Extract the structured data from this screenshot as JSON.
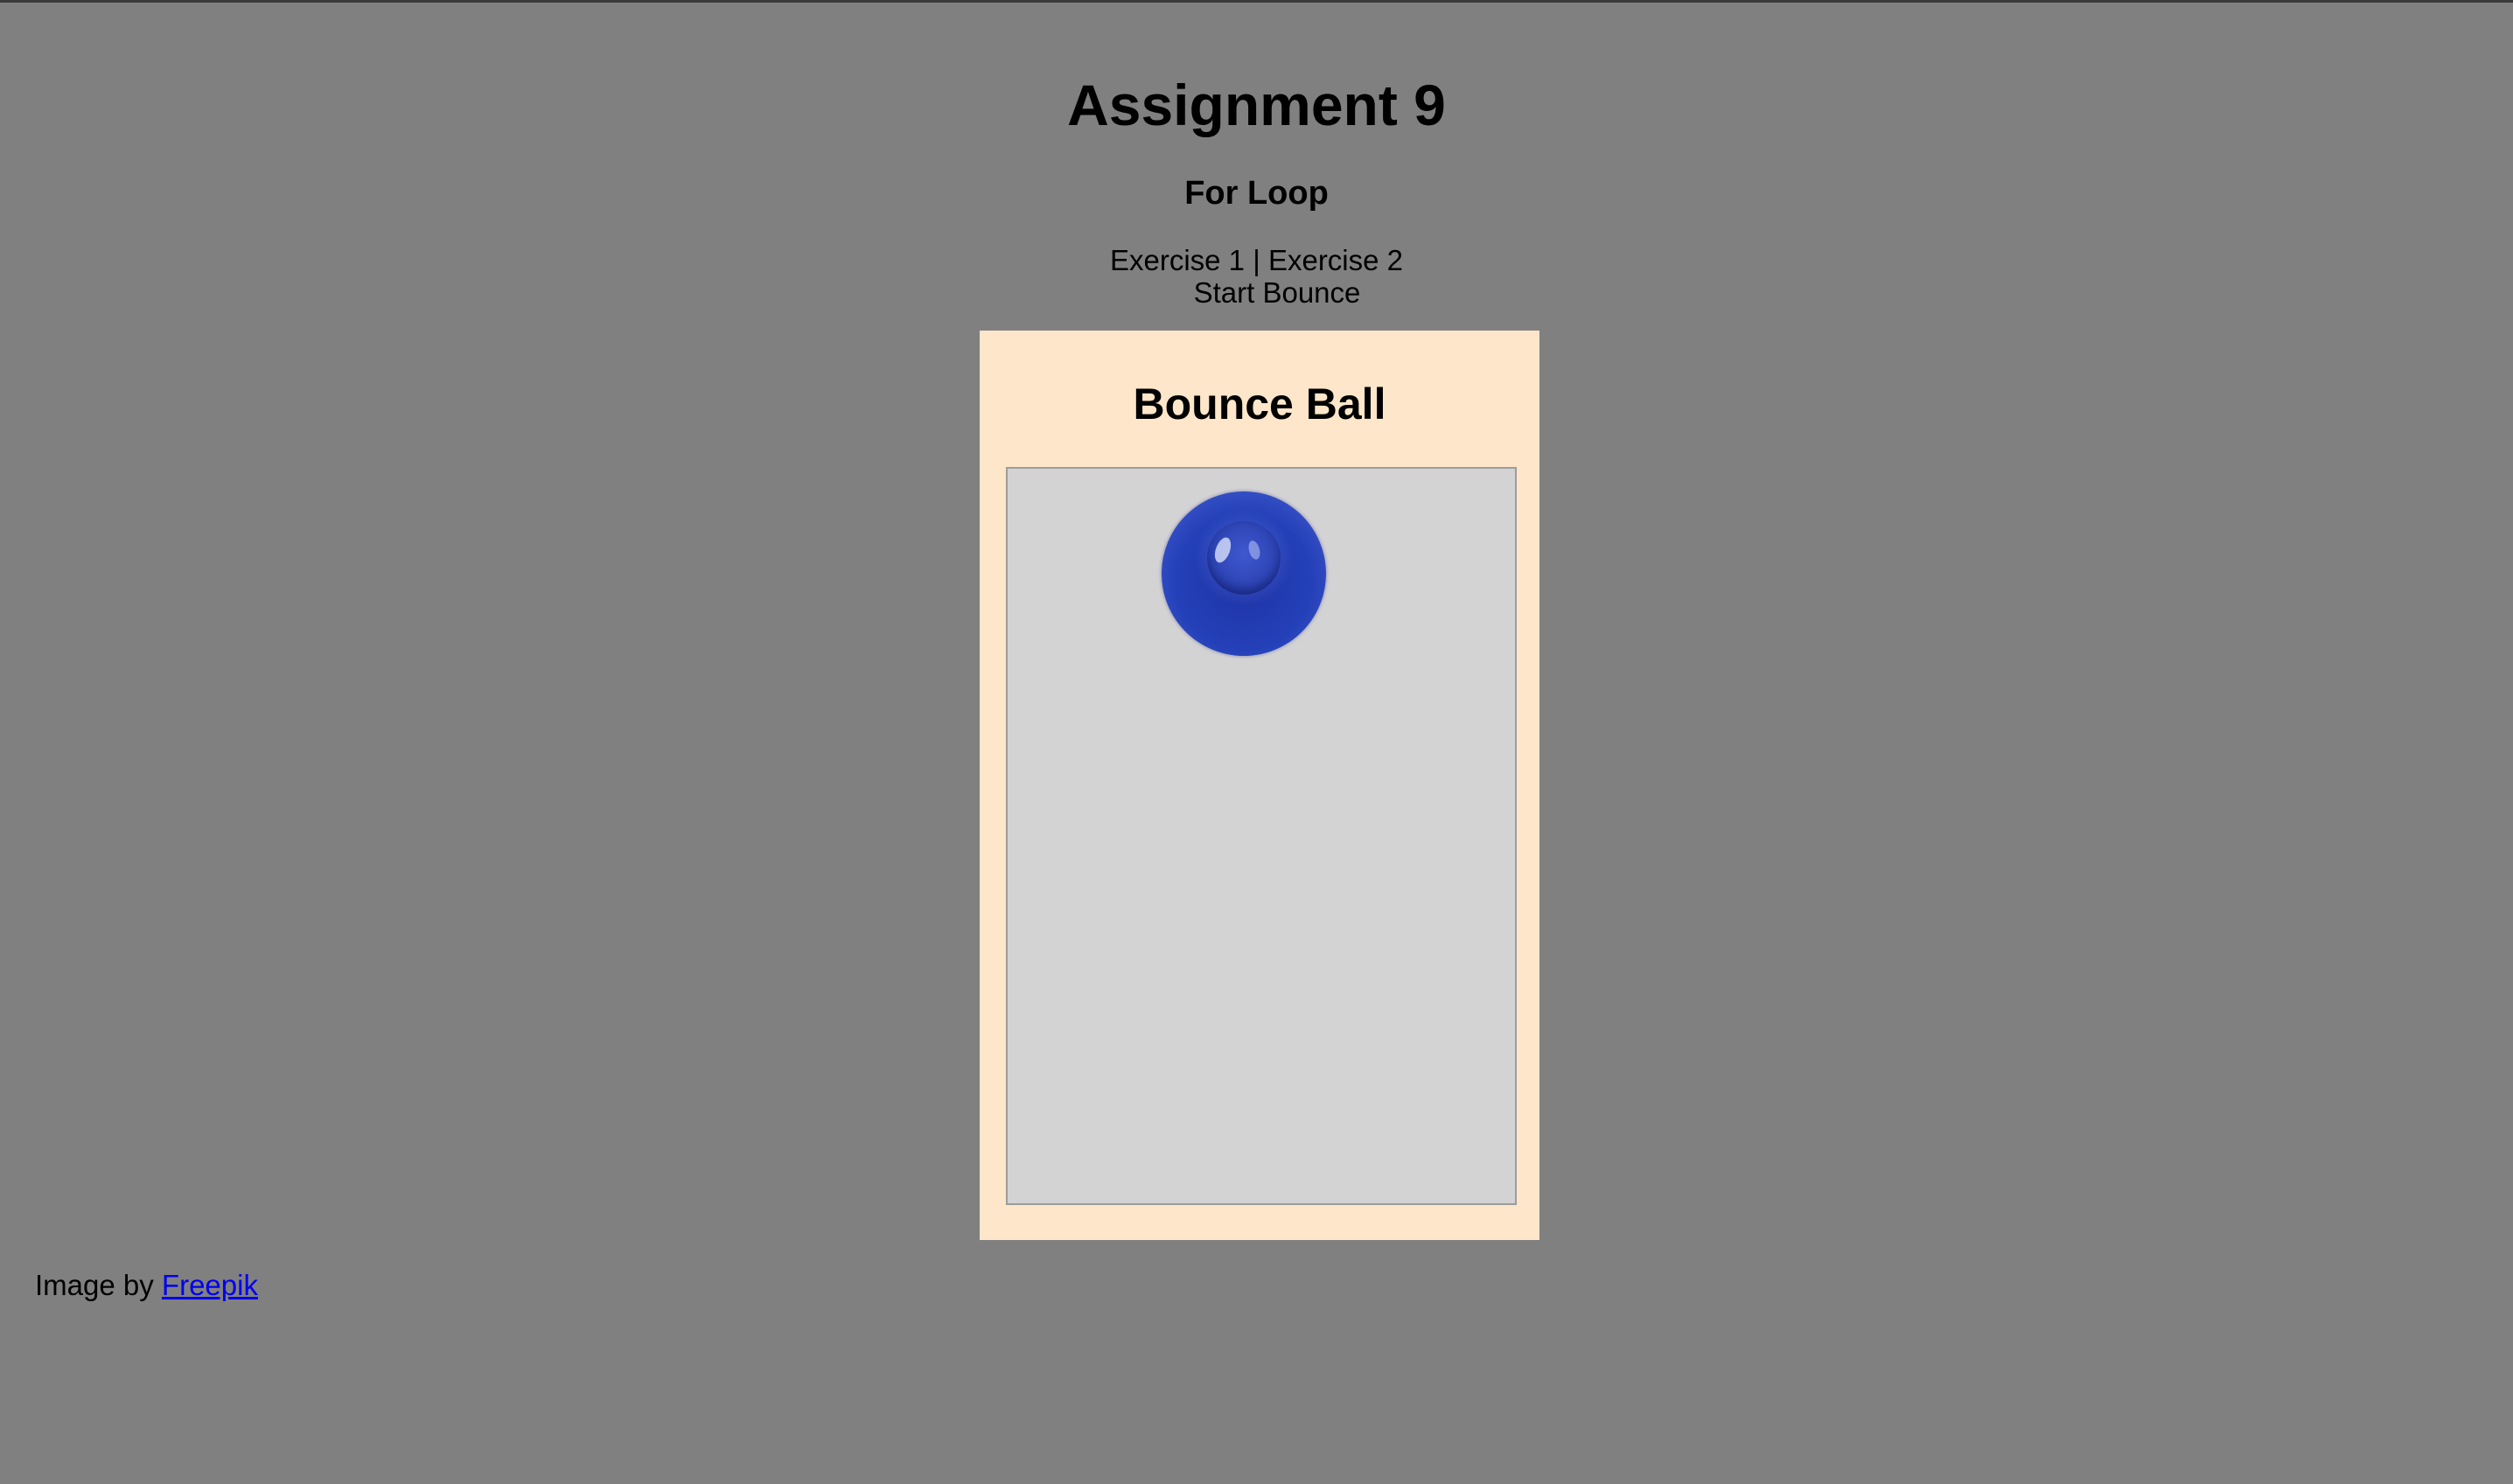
{
  "header": {
    "title": "Assignment 9",
    "subtitle": "For Loop"
  },
  "nav": {
    "exercise1": "Exercise 1",
    "separator": "|",
    "exercise2": "Exercise 2"
  },
  "controls": {
    "start_label": "Start Bounce"
  },
  "card": {
    "title": "Bounce Ball"
  },
  "footer": {
    "credit_prefix": "Image by",
    "credit_link": "Freepik"
  },
  "colors": {
    "page_background": "#808080",
    "card_background": "#fde6c9",
    "arena_background": "#d4d3d4",
    "ball": "#2440b8",
    "link": "#0000ee"
  },
  "icons": {
    "ball": "blue-ball-image"
  }
}
